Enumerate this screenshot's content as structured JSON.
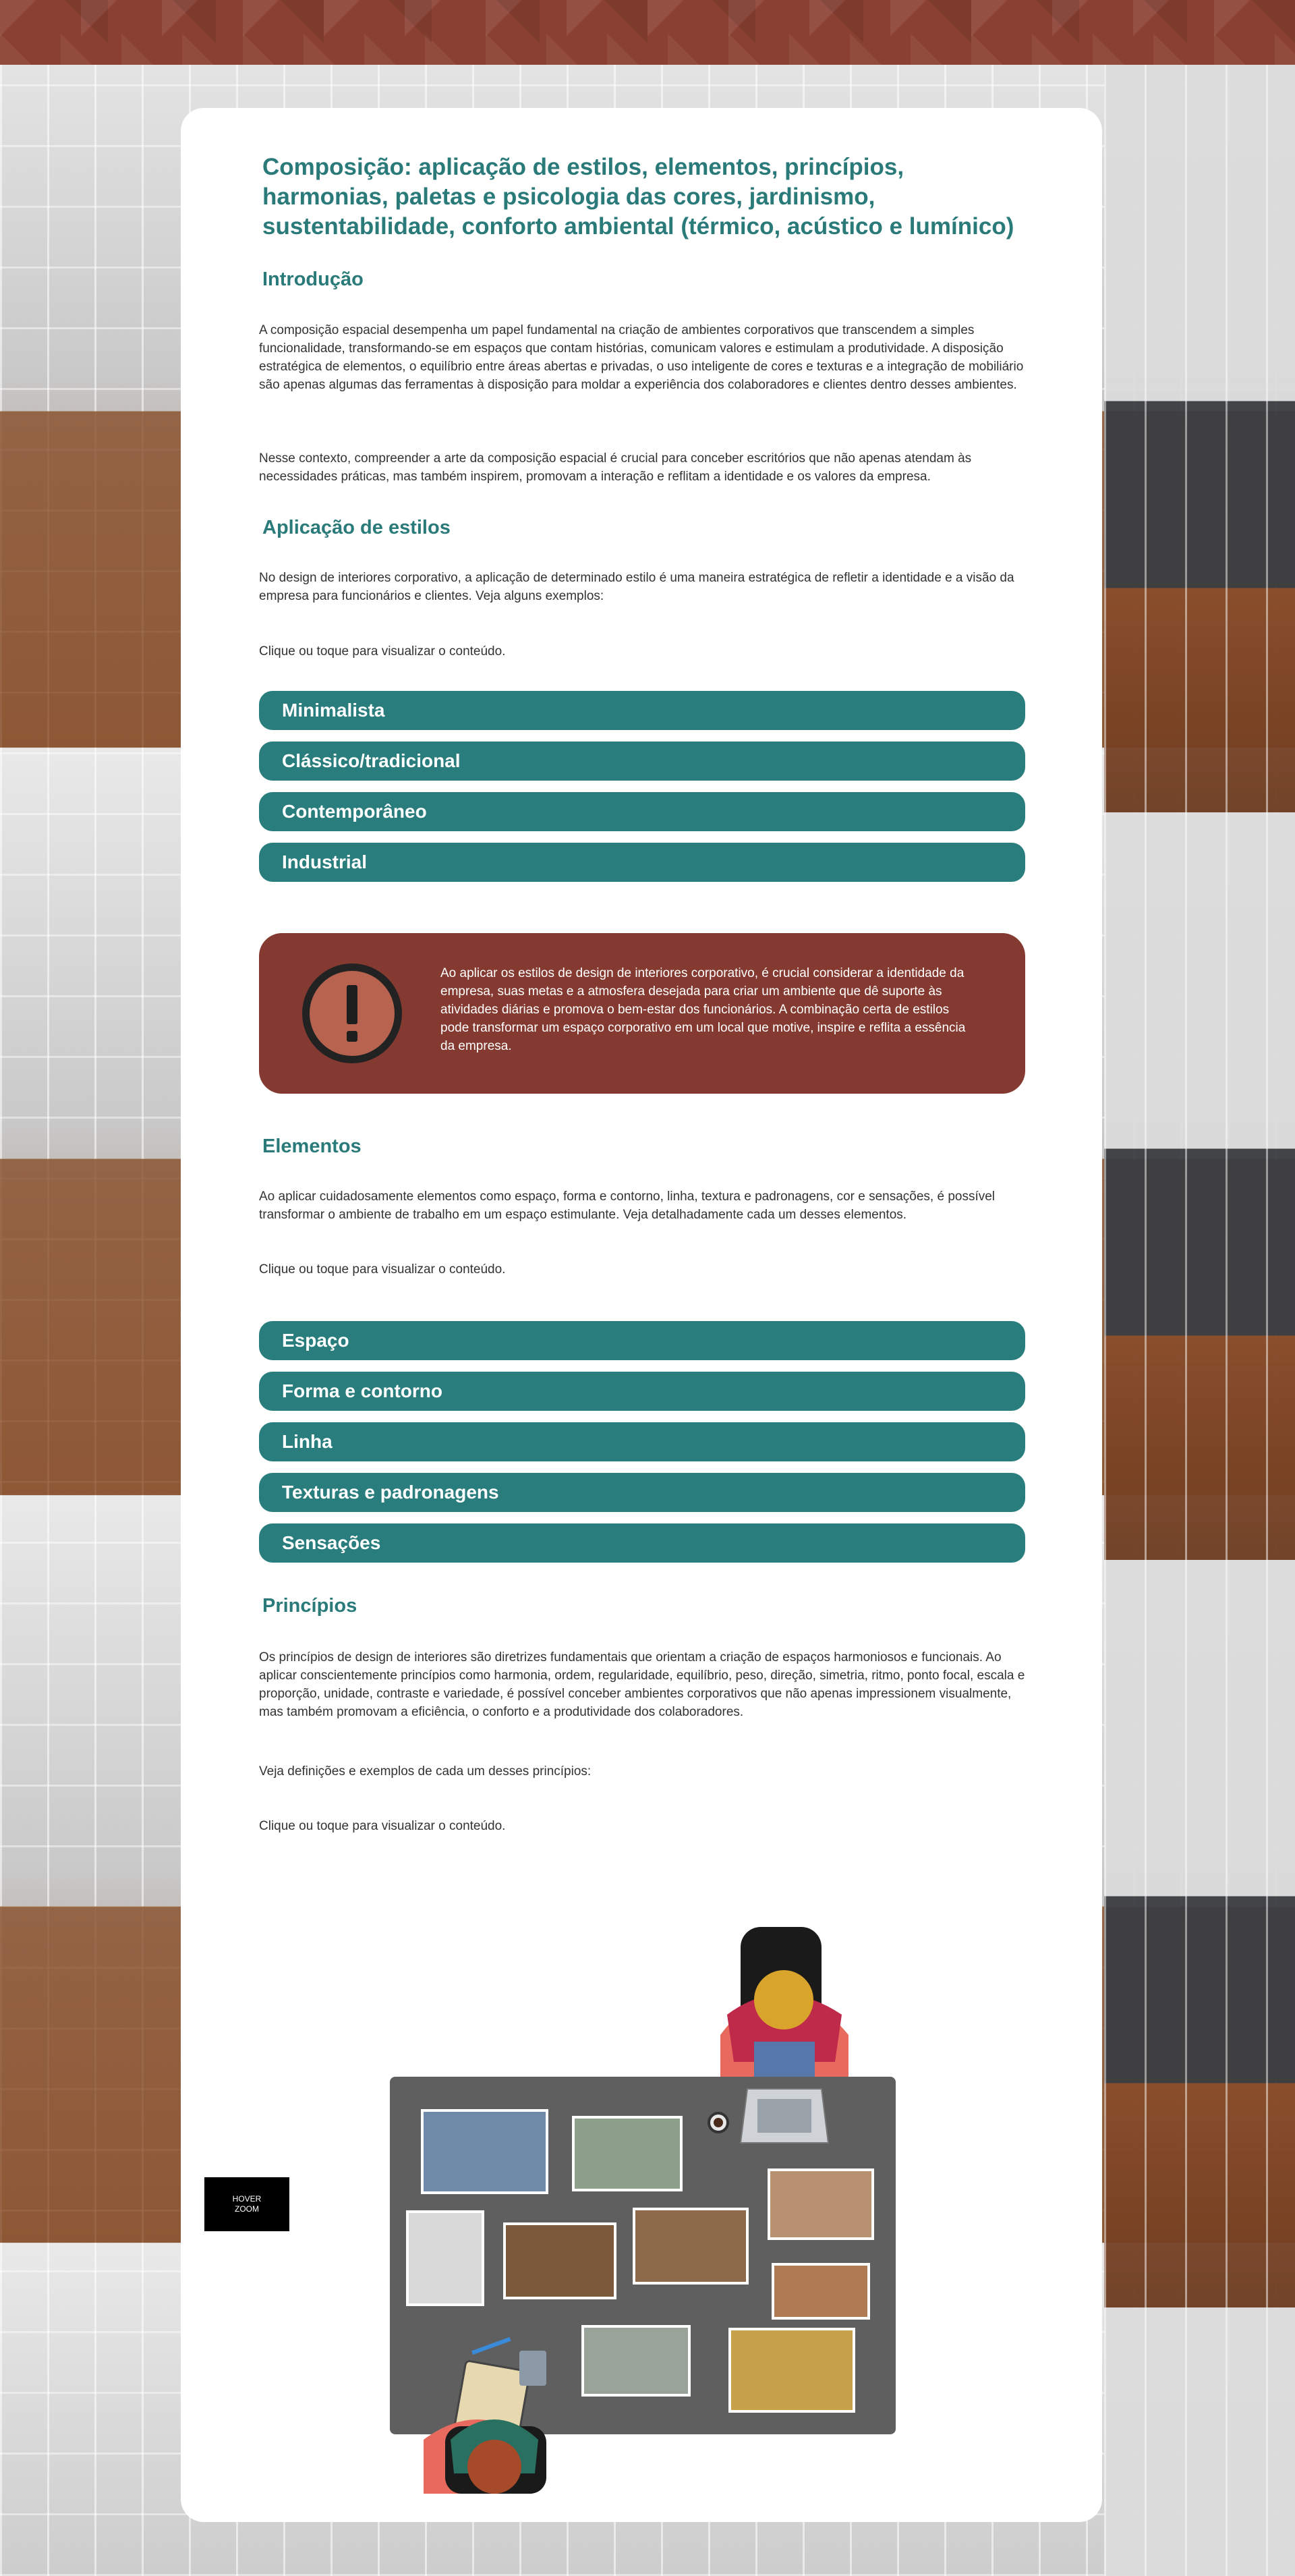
{
  "title": "Composição: aplicação de estilos, elementos, princípios, harmonias, paletas e psicologia das cores, jardinismo, sustentabilidade, conforto ambiental (térmico, acústico e lumínico)",
  "intro": {
    "heading": "Introdução",
    "p1": "A composição espacial desempenha um papel fundamental na criação de ambientes corporativos que transcendem a simples funcionalidade, transformando-se em espaços que contam histórias, comunicam valores e estimulam a produtividade. A disposição estratégica de elementos, o equilíbrio entre áreas abertas e privadas, o uso inteligente de cores e texturas e a integração de mobiliário são apenas algumas das ferramentas à disposição para moldar a experiência dos colaboradores e clientes dentro desses ambientes.",
    "p2": "Nesse contexto, compreender a arte da composição espacial é crucial para conceber escritórios que não apenas atendam às necessidades práticas, mas também inspirem, promovam a interação e reflitam a identidade e os valores da empresa."
  },
  "styles": {
    "heading": "Aplicação de estilos",
    "p1": "No design de interiores corporativo, a aplicação de determinado estilo é uma maneira estratégica de refletir a identidade e a visão da empresa para funcionários e clientes. Veja alguns exemplos:",
    "hint": "Clique ou toque para visualizar o conteúdo.",
    "items": [
      "Minimalista",
      "Clássico/tradicional",
      "Contemporâneo",
      "Industrial"
    ],
    "callout": "Ao aplicar os estilos de design de interiores corporativo, é crucial considerar a identidade da empresa, suas metas e a atmosfera desejada para criar um ambiente que dê suporte às atividades diárias e promova o bem-estar dos funcionários. A combinação certa de estilos pode transformar um espaço corporativo em um local que motive, inspire e reflita a essência da empresa."
  },
  "elements": {
    "heading": "Elementos",
    "p1": "Ao aplicar cuidadosamente elementos como espaço, forma e contorno, linha, textura e padronagens, cor e sensações, é possível transformar o ambiente de trabalho em um espaço estimulante. Veja detalhadamente cada um desses elementos.",
    "hint": "Clique ou toque para visualizar o conteúdo.",
    "items": [
      "Espaço",
      "Forma e contorno",
      "Linha",
      "Texturas e padronagens",
      "Sensações"
    ]
  },
  "principles": {
    "heading": "Princípios",
    "p1": "Os princípios de design de interiores são diretrizes fundamentais que orientam a criação de espaços harmoniosos e funcionais. Ao aplicar conscientemente princípios como harmonia, ordem, regularidade, equilíbrio, peso, direção, simetria, ritmo, ponto focal, escala e proporção, unidade, contraste e variedade, é possível conceber ambientes corporativos que não apenas impressionem visualmente, mas também promovam a eficiência, o conforto e a produtividade dos colaboradores.",
    "p2": "Veja definições e exemplos de cada um desses princípios:",
    "hint": "Clique ou toque para visualizar o conteúdo."
  },
  "hover_zoom": {
    "line1": "HOVER",
    "line2": "ZOOM"
  },
  "colors": {
    "accent": "#2a7d7d",
    "callout": "#843a30",
    "banner": "#8b4132"
  }
}
